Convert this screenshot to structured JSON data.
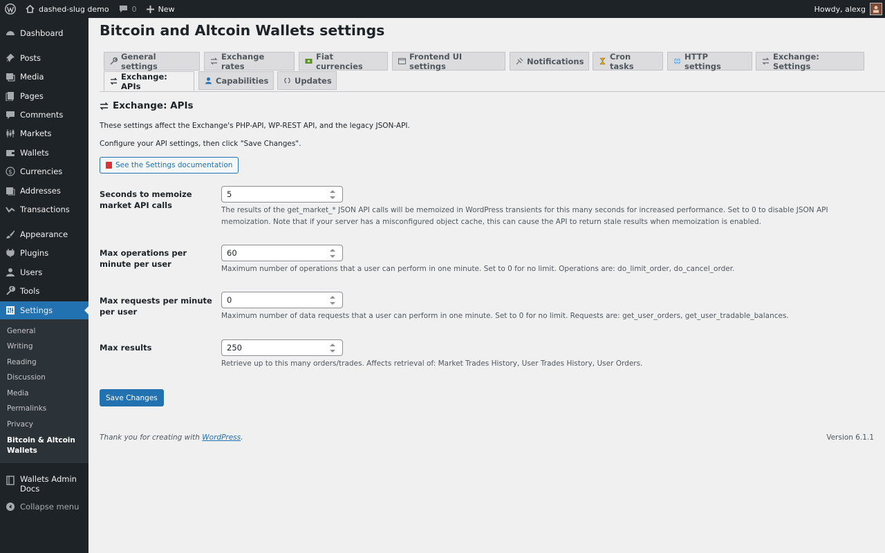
{
  "adminbar": {
    "site_name": "dashed-slug demo",
    "comments_count": "0",
    "new_label": "New",
    "howdy": "Howdy, alexg"
  },
  "sidebar": {
    "items": [
      {
        "label": "Dashboard",
        "icon": "dashboard-icon"
      },
      {
        "label": "Posts",
        "icon": "pin-icon"
      },
      {
        "label": "Media",
        "icon": "media-icon"
      },
      {
        "label": "Pages",
        "icon": "page-icon"
      },
      {
        "label": "Comments",
        "icon": "comment-icon"
      },
      {
        "label": "Markets",
        "icon": "candlestick-icon"
      },
      {
        "label": "Wallets",
        "icon": "wallet-icon"
      },
      {
        "label": "Currencies",
        "icon": "dollar-icon"
      },
      {
        "label": "Addresses",
        "icon": "address-icon"
      },
      {
        "label": "Transactions",
        "icon": "chart-icon"
      },
      {
        "label": "Appearance",
        "icon": "brush-icon"
      },
      {
        "label": "Plugins",
        "icon": "plugin-icon"
      },
      {
        "label": "Users",
        "icon": "user-icon"
      },
      {
        "label": "Tools",
        "icon": "wrench-icon"
      },
      {
        "label": "Settings",
        "icon": "settings-icon"
      },
      {
        "label": "Wallets Admin Docs",
        "icon": "book-icon"
      },
      {
        "label": "Collapse menu",
        "icon": "collapse-icon"
      }
    ],
    "submenu": [
      "General",
      "Writing",
      "Reading",
      "Discussion",
      "Media",
      "Permalinks",
      "Privacy",
      "Bitcoin & Altcoin Wallets"
    ]
  },
  "page": {
    "title": "Bitcoin and Altcoin Wallets settings",
    "tabs": [
      "General settings",
      "Exchange rates",
      "Fiat currencies",
      "Frontend UI settings",
      "Notifications",
      "Cron tasks",
      "HTTP settings",
      "Exchange: Settings",
      "Exchange: APIs",
      "Capabilities",
      "Updates"
    ],
    "active_tab": "Exchange: APIs",
    "section_title": "Exchange: APIs",
    "intro1": "These settings affect the Exchange's PHP-API, WP-REST API, and the legacy JSON-API.",
    "intro2": "Configure your API settings, then click \"Save Changes\".",
    "doc_button": "See the Settings documentation"
  },
  "fields": [
    {
      "label": "Seconds to memoize market API calls",
      "value": "5",
      "help": "The results of the get_market_* JSON API calls will be memoized in WordPress transients for this many seconds for increased performance. Set to 0 to disable JSON API memoization. Note that if your server has a misconfigured object cache, this can cause the API to return stale results when memoization is enabled."
    },
    {
      "label": "Max operations per minute per user",
      "value": "60",
      "help": "Maximum number of operations that a user can perform in one minute. Set to 0 for no limit. Operations are: do_limit_order, do_cancel_order."
    },
    {
      "label": "Max requests per minute per user",
      "value": "0",
      "help": "Maximum number of data requests that a user can perform in one minute. Set to 0 for no limit. Requests are: get_user_orders, get_user_tradable_balances."
    },
    {
      "label": "Max results",
      "value": "250",
      "help": "Retrieve up to this many orders/trades. Affects retrieval of: Market Trades History, User Trades History, User Orders."
    }
  ],
  "save_label": "Save Changes",
  "footer": {
    "thanks_prefix": "Thank you for creating with",
    "thanks_link": "WordPress",
    "thanks_suffix": ".",
    "version": "Version 6.1.1"
  },
  "colors": {
    "accent": "#2271b1",
    "adminbar_bg": "#1d2327",
    "submenu_bg": "#2c3338",
    "page_bg": "#f0f0f1"
  }
}
